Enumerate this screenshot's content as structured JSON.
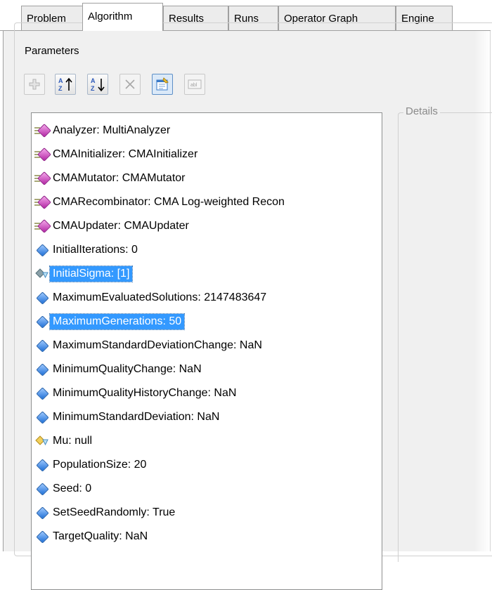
{
  "tabs": [
    {
      "label": "Problem",
      "active": false
    },
    {
      "label": "Algorithm",
      "active": true
    },
    {
      "label": "Results",
      "active": false
    },
    {
      "label": "Runs",
      "active": false
    },
    {
      "label": "Operator Graph",
      "active": false
    },
    {
      "label": "Engine",
      "active": false
    }
  ],
  "parameters": {
    "group_label": "Parameters",
    "toolbar": {
      "add": {
        "icon": "plus-icon",
        "enabled": false
      },
      "sort_asc": {
        "icon": "sort-az-asc-icon",
        "enabled": true
      },
      "sort_desc": {
        "icon": "sort-az-desc-icon",
        "enabled": true
      },
      "remove": {
        "icon": "x-icon",
        "enabled": false
      },
      "properties": {
        "icon": "properties-icon",
        "enabled": true,
        "pressed": true
      },
      "rename": {
        "icon": "rename-textbox-icon",
        "enabled": false
      }
    },
    "items": [
      {
        "text": "Analyzer: MultiAnalyzer",
        "icon": "operator-parameter-icon",
        "selected": false
      },
      {
        "text": "CMAInitializer: CMAInitializer",
        "icon": "operator-parameter-icon",
        "selected": false
      },
      {
        "text": "CMAMutator: CMAMutator",
        "icon": "operator-parameter-icon",
        "selected": false
      },
      {
        "text": "CMARecombinator: CMA Log-weighted Recon",
        "icon": "operator-parameter-icon",
        "selected": false
      },
      {
        "text": "CMAUpdater: CMAUpdater",
        "icon": "operator-parameter-icon",
        "selected": false
      },
      {
        "text": "InitialIterations: 0",
        "icon": "value-parameter-icon",
        "selected": false
      },
      {
        "text": "InitialSigma: [1]",
        "icon": "optional-value-parameter-icon",
        "selected": true
      },
      {
        "text": "MaximumEvaluatedSolutions: 2147483647",
        "icon": "value-parameter-icon",
        "selected": false
      },
      {
        "text": "MaximumGenerations: 50",
        "icon": "value-parameter-icon",
        "selected": true
      },
      {
        "text": "MaximumStandardDeviationChange: NaN",
        "icon": "value-parameter-icon",
        "selected": false
      },
      {
        "text": "MinimumQualityChange: NaN",
        "icon": "value-parameter-icon",
        "selected": false
      },
      {
        "text": "MinimumQualityHistoryChange: NaN",
        "icon": "value-parameter-icon",
        "selected": false
      },
      {
        "text": "MinimumStandardDeviation: NaN",
        "icon": "value-parameter-icon",
        "selected": false
      },
      {
        "text": "Mu: null",
        "icon": "optional-constrained-parameter-icon",
        "selected": false
      },
      {
        "text": "PopulationSize: 20",
        "icon": "value-parameter-icon",
        "selected": false
      },
      {
        "text": "Seed: 0",
        "icon": "value-parameter-icon",
        "selected": false
      },
      {
        "text": "SetSeedRandomly: True",
        "icon": "value-parameter-icon",
        "selected": false
      },
      {
        "text": "TargetQuality: NaN",
        "icon": "value-parameter-icon",
        "selected": false
      }
    ]
  },
  "details": {
    "group_label": "Details"
  },
  "colors": {
    "selection": "#3399ff",
    "panel": "#f0f0f0"
  }
}
